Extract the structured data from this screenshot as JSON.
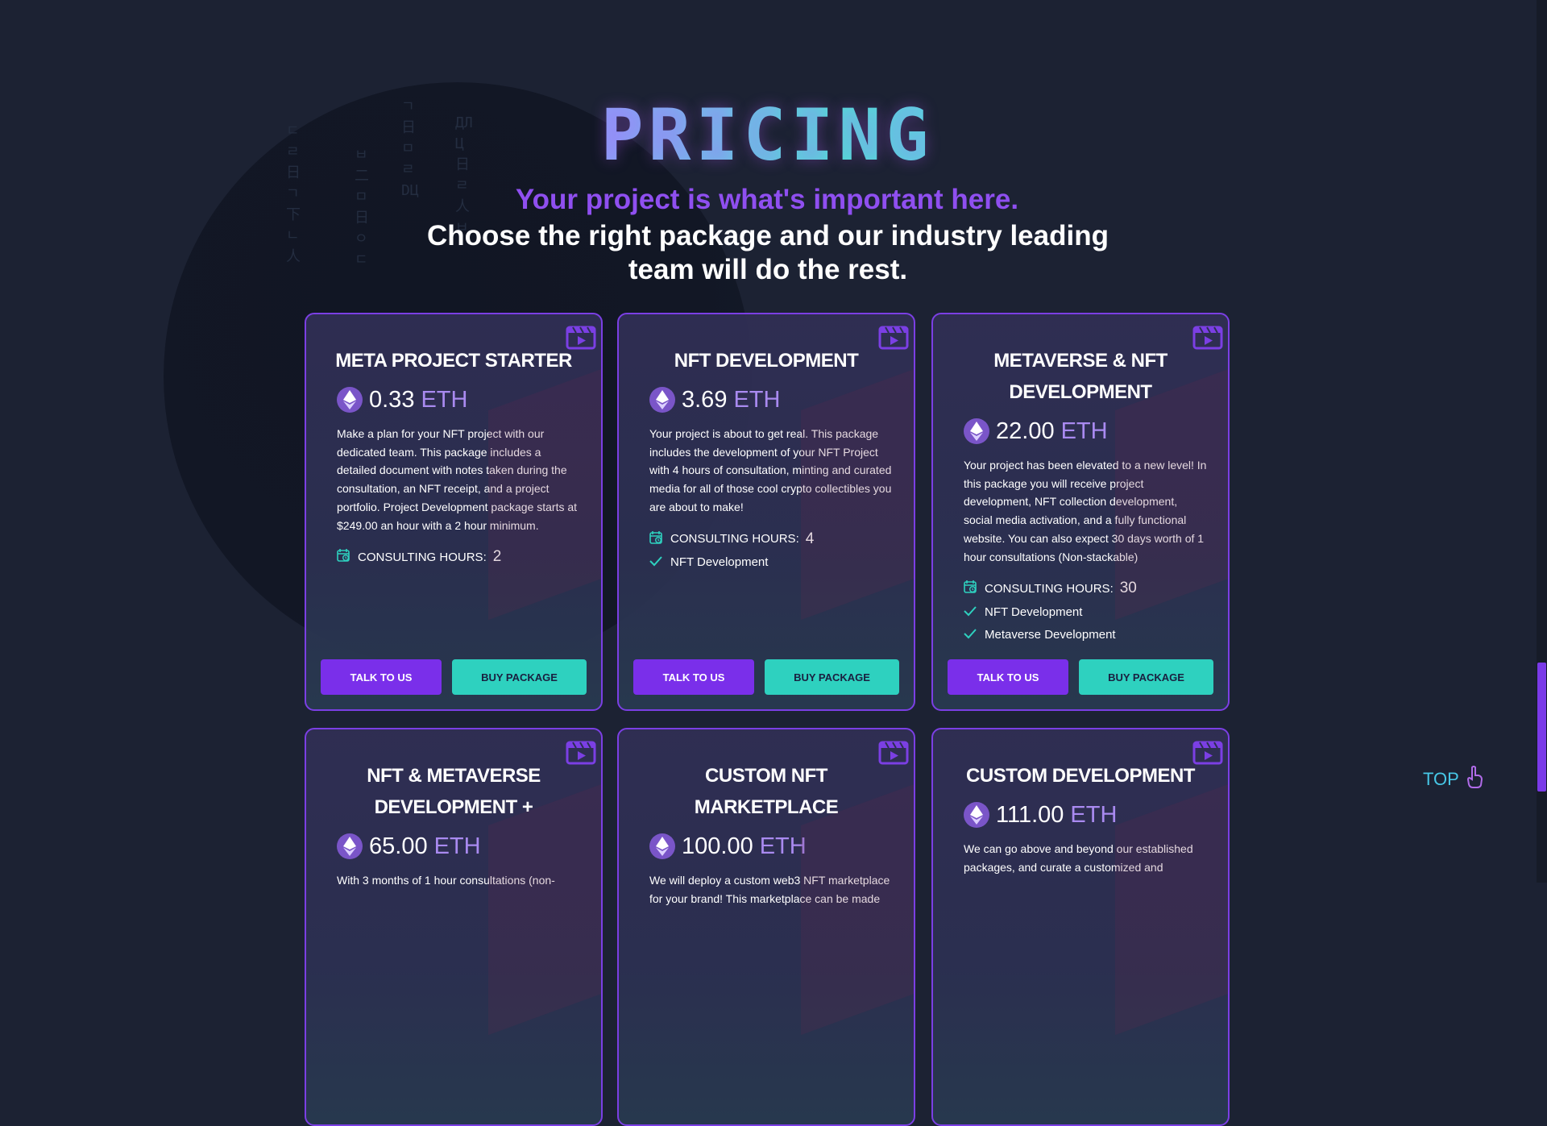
{
  "header": {
    "title": "PRICING",
    "subtitle_highlight": "Your project is what's important here.",
    "subtitle": "Choose the right package and our industry leading team will do the rest."
  },
  "colors": {
    "background": "#1c2233",
    "accent_purple": "#7a2fea",
    "accent_teal": "#2ed1bf",
    "card_border": "#7b3fe4",
    "eth_unit": "#a98af0"
  },
  "icons": {
    "card_corner": "video-play-icon",
    "price": "ethereum-icon",
    "hours": "calendar-clock-icon",
    "feature": "checkmark-icon",
    "top": "pointing-hand-icon"
  },
  "cards": [
    {
      "title": "META PROJECT STARTER",
      "price": "0.33",
      "unit": "ETH",
      "description": "Make a plan for your NFT project with our dedicated team. This package includes a detailed document with notes taken during the consultation, an NFT receipt, and a project portfolio. Project Development package starts at $249.00 an hour with a 2 hour minimum.",
      "hours_label": "CONSULTING HOURS:",
      "hours_value": "2",
      "features": [],
      "talk_label": "TALK TO US",
      "buy_label": "BUY PACKAGE"
    },
    {
      "title": "NFT DEVELOPMENT",
      "price": "3.69",
      "unit": "ETH",
      "description": "Your project is about to get real. This package includes the development of your NFT Project with 4 hours of consultation, minting and curated media for all of those cool crypto collectibles you are about to make!",
      "hours_label": "CONSULTING HOURS:",
      "hours_value": "4",
      "features": [
        "NFT Development"
      ],
      "talk_label": "TALK TO US",
      "buy_label": "BUY PACKAGE"
    },
    {
      "title": "METAVERSE & NFT DEVELOPMENT",
      "price": "22.00",
      "unit": "ETH",
      "description": "Your project has been elevated to a new level! In this package you will receive project development, NFT collection development, social media activation, and a fully functional website. You can also expect 30 days worth of 1 hour consultations (Non-stackable)",
      "hours_label": "CONSULTING HOURS:",
      "hours_value": "30",
      "features": [
        "NFT Development",
        "Metaverse Development"
      ],
      "talk_label": "TALK TO US",
      "buy_label": "BUY PACKAGE"
    },
    {
      "title": "NFT & METAVERSE DEVELOPMENT +",
      "price": "65.00",
      "unit": "ETH",
      "description": "With 3 months of 1 hour consultations (non-",
      "hours_label": "",
      "hours_value": "",
      "features": [],
      "talk_label": "",
      "buy_label": ""
    },
    {
      "title": "CUSTOM NFT MARKETPLACE",
      "price": "100.00",
      "unit": "ETH",
      "description": "We will deploy a custom web3 NFT marketplace for your brand! This marketplace can be made",
      "hours_label": "",
      "hours_value": "",
      "features": [],
      "talk_label": "",
      "buy_label": ""
    },
    {
      "title": "CUSTOM DEVELOPMENT",
      "price": "111.00",
      "unit": "ETH",
      "description": "We can go above and beyond our established packages, and curate a customized and",
      "hours_label": "",
      "hours_value": "",
      "features": [],
      "talk_label": "",
      "buy_label": ""
    }
  ],
  "top_link": {
    "label": "TOP"
  },
  "scroll": {
    "position_fraction": 0.75
  }
}
